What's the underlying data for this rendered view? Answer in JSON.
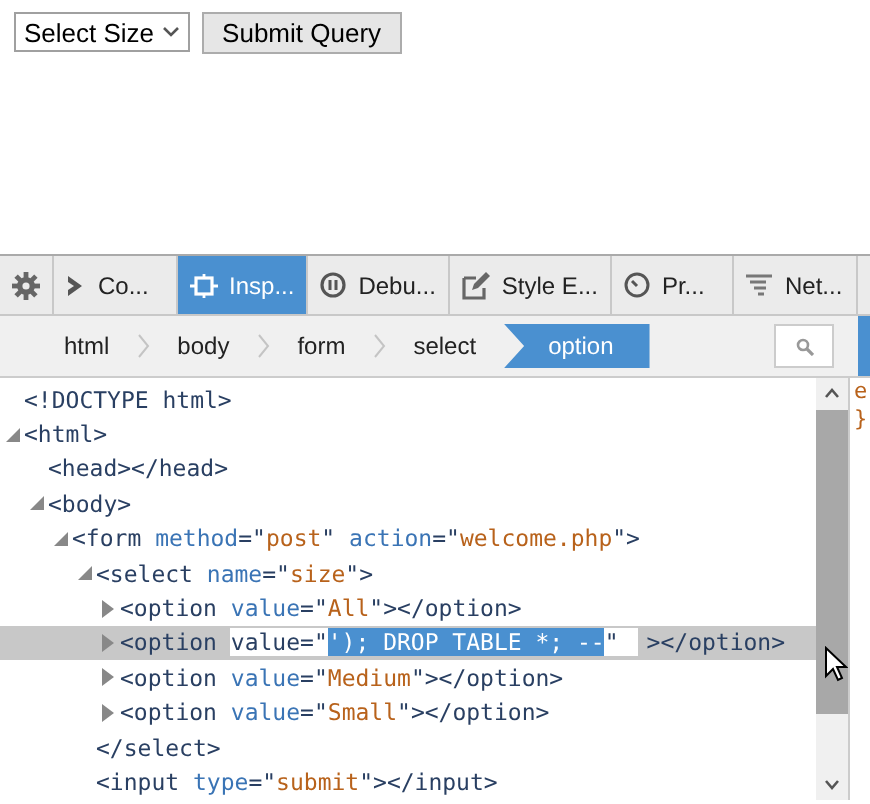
{
  "page": {
    "select": {
      "value": "Select Size"
    },
    "submit_button": {
      "label": "Submit Query"
    }
  },
  "toolbar": {
    "tabs": [
      {
        "kind": "console",
        "label": "Co...",
        "selected": false
      },
      {
        "kind": "inspector",
        "label": "Insp...",
        "selected": true
      },
      {
        "kind": "debugger",
        "label": "Debu...",
        "selected": false
      },
      {
        "kind": "style",
        "label": "Style E...",
        "selected": false
      },
      {
        "kind": "performance",
        "label": "Pr...",
        "selected": false
      },
      {
        "kind": "network",
        "label": "Net...",
        "selected": false
      }
    ]
  },
  "breadcrumbs": [
    {
      "label": "html",
      "selected": false
    },
    {
      "label": "body",
      "selected": false
    },
    {
      "label": "form",
      "selected": false
    },
    {
      "label": "select",
      "selected": false
    },
    {
      "label": "option",
      "selected": true
    }
  ],
  "tree": [
    {
      "parts": [
        {
          "kind": "tag",
          "text": "<!DOCTYPE html>"
        }
      ],
      "selected": false
    },
    {
      "parts": [
        {
          "kind": "tag",
          "text": "<html>"
        }
      ],
      "expanded": true,
      "selected": false,
      "children": [
        {
          "parts": [
            {
              "kind": "tag",
              "text": "<head></head>"
            }
          ],
          "selected": false
        },
        {
          "parts": [
            {
              "kind": "tag",
              "text": "<body>"
            }
          ],
          "expanded": true,
          "selected": false,
          "children": [
            {
              "parts": [
                {
                  "kind": "tag",
                  "text": "<form"
                },
                {
                  "kind": "attr",
                  "text": "method"
                },
                {
                  "kind": "tag",
                  "text": "=\""
                },
                {
                  "kind": "value",
                  "text": "post"
                },
                {
                  "kind": "tag",
                  "text": "\""
                },
                {
                  "kind": "attr",
                  "text": "action"
                },
                {
                  "kind": "tag",
                  "text": "=\""
                },
                {
                  "kind": "value",
                  "text": "welcome.php"
                },
                {
                  "kind": "tag",
                  "text": "\">"
                }
              ],
              "expanded": true,
              "selected": false,
              "children": [
                {
                  "parts": [
                    {
                      "kind": "tag",
                      "text": "<select"
                    },
                    {
                      "kind": "attr",
                      "text": "name"
                    },
                    {
                      "kind": "tag",
                      "text": "=\""
                    },
                    {
                      "kind": "value",
                      "text": "size"
                    },
                    {
                      "kind": "tag",
                      "text": "\">"
                    }
                  ],
                  "expanded": true,
                  "selected": false,
                  "children": [
                    {
                      "parts": [
                        {
                          "kind": "tag",
                          "text": "<option"
                        },
                        {
                          "kind": "attr",
                          "text": "value"
                        },
                        {
                          "kind": "tag",
                          "text": "=\""
                        },
                        {
                          "kind": "value",
                          "text": "All"
                        },
                        {
                          "kind": "tag",
                          "text": "\"></option>"
                        }
                      ],
                      "expanded": false,
                      "selected": false
                    },
                    {
                      "parts": [
                        {
                          "kind": "tag",
                          "text": "<option"
                        },
                        {
                          "kind": "editor",
                          "prefix": "value=\"",
                          "selection": "'); DROP TABLE *; --",
                          "suffix": "\""
                        },
                        {
                          "kind": "tag",
                          "text": "></option>"
                        }
                      ],
                      "expanded": false,
                      "selected": true
                    },
                    {
                      "parts": [
                        {
                          "kind": "tag",
                          "text": "<option"
                        },
                        {
                          "kind": "attr",
                          "text": "value"
                        },
                        {
                          "kind": "tag",
                          "text": "=\""
                        },
                        {
                          "kind": "value",
                          "text": "Medium"
                        },
                        {
                          "kind": "tag",
                          "text": "\"></option>"
                        }
                      ],
                      "expanded": false,
                      "selected": false
                    },
                    {
                      "parts": [
                        {
                          "kind": "tag",
                          "text": "<option"
                        },
                        {
                          "kind": "attr",
                          "text": "value"
                        },
                        {
                          "kind": "tag",
                          "text": "=\""
                        },
                        {
                          "kind": "value",
                          "text": "Small"
                        },
                        {
                          "kind": "tag",
                          "text": "\"></option>"
                        }
                      ],
                      "expanded": false,
                      "selected": false
                    }
                  ]
                },
                {
                  "parts": [
                    {
                      "kind": "tag",
                      "text": "</select>"
                    }
                  ],
                  "selected": false
                },
                {
                  "parts": [
                    {
                      "kind": "tag",
                      "text": "<input"
                    },
                    {
                      "kind": "attr",
                      "text": "type"
                    },
                    {
                      "kind": "tag",
                      "text": "=\""
                    },
                    {
                      "kind": "value",
                      "text": "submit"
                    },
                    {
                      "kind": "tag",
                      "text": "\"></input>"
                    }
                  ],
                  "selected": false
                }
              ]
            }
          ]
        }
      ]
    }
  ],
  "side_panel": {
    "lines": [
      "e",
      "}"
    ]
  }
}
